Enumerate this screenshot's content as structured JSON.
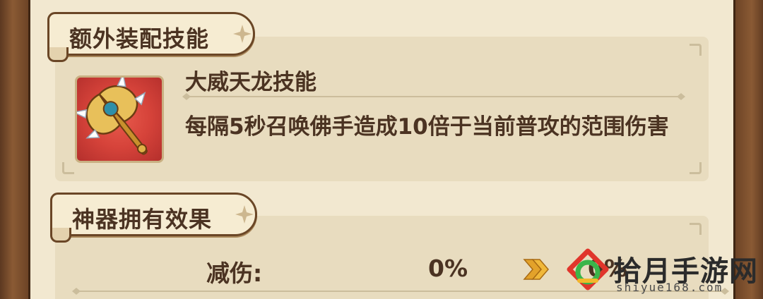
{
  "sections": {
    "extra_skill": {
      "title": "额外装配技能",
      "skill_name": "大威天龙技能",
      "description": "每隔5秒召唤佛手造成10倍于当前普攻的范围伤害",
      "icon": "golden-axe-weapon-icon"
    },
    "artifact_effect": {
      "title": "神器拥有效果",
      "stat_label": "减伤:",
      "current_value": "0%",
      "next_value": "0%"
    }
  },
  "watermark": {
    "name": "拾月手游网",
    "url": "shiyue168.com"
  },
  "colors": {
    "frame": "#7a4e2e",
    "parchment": "#f2e8d0",
    "card": "#e8dcbf",
    "text": "#4b3322",
    "arrow": "#e3a22a",
    "icon_bg": "#d6433a"
  }
}
